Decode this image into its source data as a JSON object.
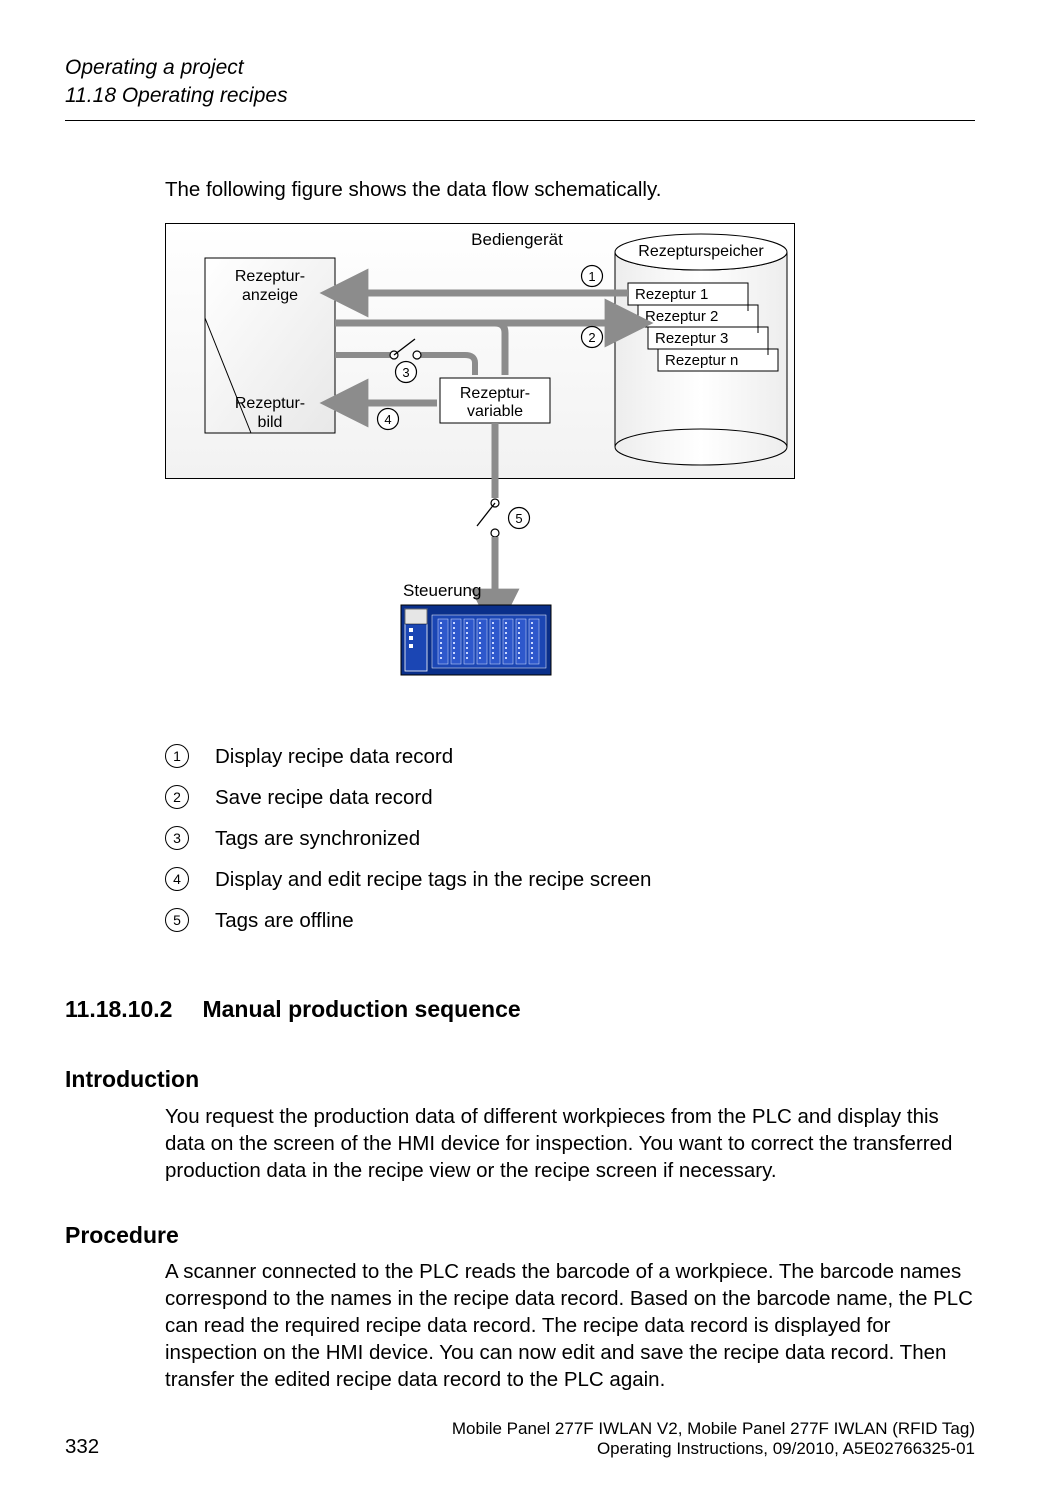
{
  "header": {
    "line1": "Operating a project",
    "line2": "11.18 Operating recipes"
  },
  "intro": "The following figure shows the data flow schematically.",
  "diagram": {
    "title_top": "Bediengerät",
    "storage_label": "Rezepturspeicher",
    "display_box_l1": "Rezeptur-",
    "display_box_l2": "anzeige",
    "screen_box_l1": "Rezeptur-",
    "screen_box_l2": "bild",
    "variable_box_l1": "Rezeptur-",
    "variable_box_l2": "variable",
    "recipes": {
      "r1": "Rezeptur 1",
      "r2": "Rezeptur 2",
      "r3": "Rezeptur 3",
      "rn": "Rezeptur n"
    },
    "plc_label": "Steuerung",
    "callouts": {
      "c1": "1",
      "c2": "2",
      "c3": "3",
      "c4": "4",
      "c5": "5"
    }
  },
  "legend": {
    "items": [
      {
        "num": "1",
        "text": "Display recipe data record"
      },
      {
        "num": "2",
        "text": "Save recipe data record"
      },
      {
        "num": "3",
        "text": "Tags are synchronized"
      },
      {
        "num": "4",
        "text": "Display and edit recipe tags in the recipe screen"
      },
      {
        "num": "5",
        "text": "Tags are offline"
      }
    ]
  },
  "section": {
    "number": "11.18.10.2",
    "title": "Manual production sequence",
    "subs": [
      {
        "heading": "Introduction",
        "body": "You request the production data of different workpieces from the PLC and display this data on the screen of the HMI device for inspection. You want to correct the transferred production data in the recipe view or the recipe screen if necessary."
      },
      {
        "heading": "Procedure",
        "body": "A scanner connected to the PLC reads the barcode of a workpiece. The barcode names correspond to the names in the recipe data record. Based on the barcode name, the PLC can read the required recipe data record. The recipe data record is displayed for inspection on the HMI device. You can now edit and save the recipe data record. Then transfer the edited recipe data record to the PLC again."
      }
    ]
  },
  "footer": {
    "page": "332",
    "device": "Mobile Panel 277F IWLAN V2, Mobile Panel 277F IWLAN (RFID Tag)",
    "docref": "Operating Instructions, 09/2010, A5E02766325-01"
  }
}
